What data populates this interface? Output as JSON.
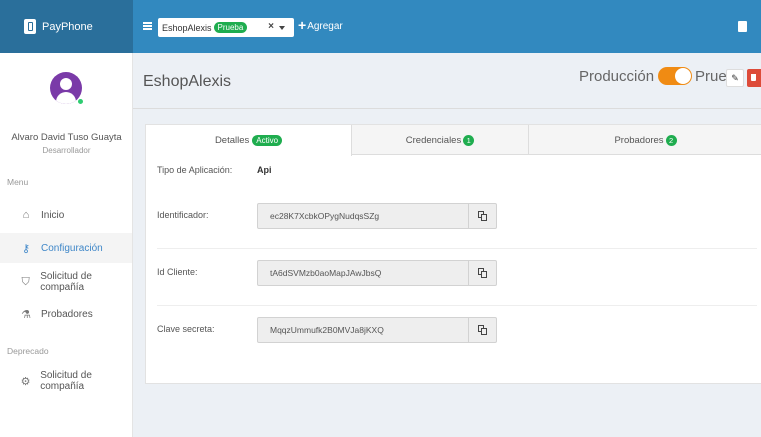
{
  "brand": {
    "name": "PayPhone"
  },
  "topbar": {
    "selected_app": "EshopAlexis",
    "selected_badge": "Prueba",
    "clear_symbol": "×",
    "add_label": "Agregar",
    "add_symbol": "+"
  },
  "user": {
    "name": "Alvaro David Tuso Guayta",
    "role": "Desarrollador"
  },
  "sidebar": {
    "menu_label": "Menu",
    "items": [
      {
        "label": "Inicio",
        "icon": "home-icon",
        "glyph": "⌂"
      },
      {
        "label": "Configuración",
        "icon": "key-icon",
        "glyph": "⚷",
        "active": true
      },
      {
        "label": "Solicitud de compañía",
        "icon": "shield-icon",
        "glyph": "⛉"
      },
      {
        "label": "Probadores",
        "icon": "flask-icon",
        "glyph": "⚗"
      }
    ],
    "deprecated_label": "Deprecado",
    "deprecated_items": [
      {
        "label": "Solicitud de compañía",
        "icon": "gears-icon",
        "glyph": "⚙"
      }
    ]
  },
  "page": {
    "title": "EshopAlexis",
    "env_left": "Producción",
    "env_right": "Prueba",
    "edit_glyph": "✎"
  },
  "tabs": [
    {
      "label": "Detalles",
      "badge": "Activo",
      "active": true
    },
    {
      "label": "Credenciales",
      "count": "1"
    },
    {
      "label": "Probadores",
      "count": "2"
    }
  ],
  "details": {
    "type_label": "Tipo de Aplicación:",
    "type_value": "Api",
    "fields": [
      {
        "label": "Identificador:",
        "value": "ec28K7XcbkOPygNudqsSZg"
      },
      {
        "label": "Id Cliente:",
        "value": "tA6dSVMzb0aoMapJAwJbsQ"
      },
      {
        "label": "Clave secreta:",
        "value": "MqqzUmmufk2B0MVJa8jKXQ"
      }
    ]
  },
  "colors": {
    "topbar_brand": "#2a6f9b",
    "topbar": "#3289bf",
    "accent_green": "#1fad4f",
    "toggle_orange": "#f08b13",
    "avatar_purple": "#7a3aa8",
    "danger": "#dd4b39",
    "active_link": "#3f87c8"
  }
}
